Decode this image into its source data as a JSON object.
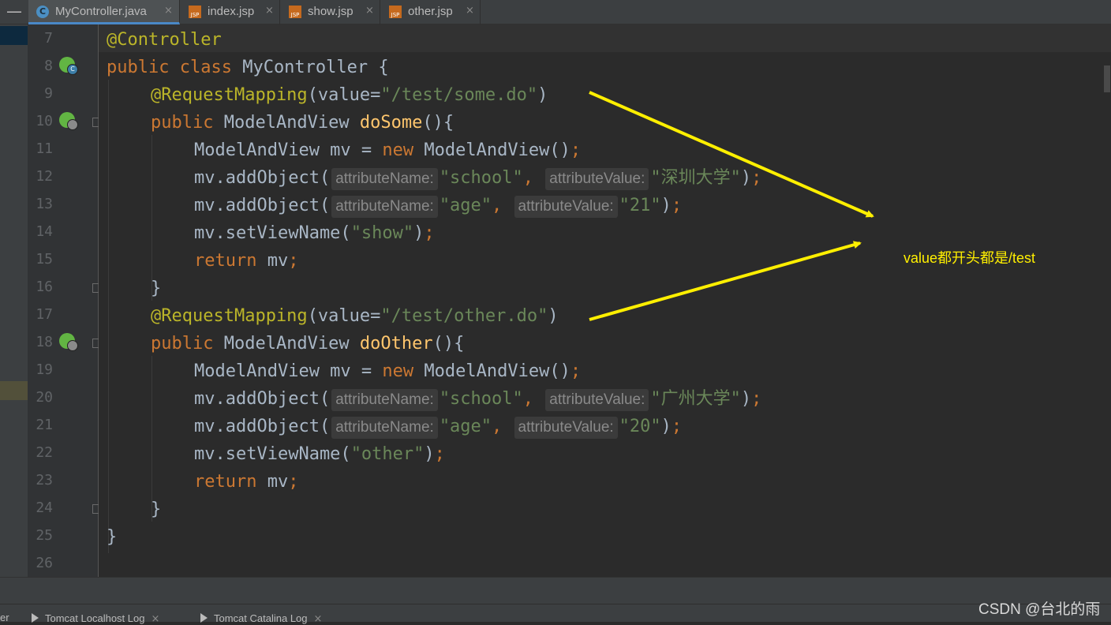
{
  "tabs": [
    {
      "label": "MyController.java",
      "icon": "java-class-icon",
      "active": true
    },
    {
      "label": "index.jsp",
      "icon": "jsp-file-icon",
      "active": false
    },
    {
      "label": "show.jsp",
      "icon": "jsp-file-icon",
      "active": false
    },
    {
      "label": "other.jsp",
      "icon": "jsp-file-icon",
      "active": false
    }
  ],
  "tab_close_glyph": "×",
  "icon_text": {
    "class_badge": "C",
    "jsp_badge": "JSP"
  },
  "line_numbers": [
    "7",
    "8",
    "9",
    "10",
    "11",
    "12",
    "13",
    "14",
    "15",
    "16",
    "17",
    "18",
    "19",
    "20",
    "21",
    "22",
    "23",
    "24",
    "25",
    "26"
  ],
  "code": {
    "l7": {
      "annotation": "@Controller"
    },
    "l8": {
      "kw1": "public ",
      "kw2": "class ",
      "rest": "MyController {"
    },
    "l9": {
      "annotation": "@RequestMapping",
      "open": "(value=",
      "str": "\"/test/some.do\"",
      "close": ")"
    },
    "l10": {
      "kw": "public ",
      "type": "ModelAndView ",
      "fn": "doSome",
      "rest": "(){"
    },
    "l11": {
      "a": "ModelAndView mv = ",
      "kw": "new ",
      "b": "ModelAndView()",
      "semi": ";"
    },
    "l12": {
      "a": "mv.addObject(",
      "h1": "attributeName:",
      "s1": "\"school\"",
      "comma": ", ",
      "h2": "attributeValue:",
      "s2": "\"深圳大学\"",
      "b": ")",
      "semi": ";"
    },
    "l13": {
      "a": "mv.addObject(",
      "h1": "attributeName:",
      "s1": "\"age\"",
      "comma": ", ",
      "h2": "attributeValue:",
      "s2": "\"21\"",
      "b": ")",
      "semi": ";"
    },
    "l14": {
      "a": "mv.setViewName(",
      "s": "\"show\"",
      "b": ")",
      "semi": ";"
    },
    "l15": {
      "kw": "return ",
      "a": "mv",
      "semi": ";"
    },
    "l16": {
      "a": "}"
    },
    "l17": {
      "annotation": "@RequestMapping",
      "open": "(value=",
      "str": "\"/test/other.do\"",
      "close": ")"
    },
    "l18": {
      "kw": "public ",
      "type": "ModelAndView ",
      "fn": "doOther",
      "rest": "(){"
    },
    "l19": {
      "a": "ModelAndView mv = ",
      "kw": "new ",
      "b": "ModelAndView()",
      "semi": ";"
    },
    "l20": {
      "a": "mv.addObject(",
      "h1": "attributeName:",
      "s1": "\"school\"",
      "comma": ", ",
      "h2": "attributeValue:",
      "s2": "\"广州大学\"",
      "b": ")",
      "semi": ";"
    },
    "l21": {
      "a": "mv.addObject(",
      "h1": "attributeName:",
      "s1": "\"age\"",
      "comma": ", ",
      "h2": "attributeValue:",
      "s2": "\"20\"",
      "b": ")",
      "semi": ";"
    },
    "l22": {
      "a": "mv.setViewName(",
      "s": "\"other\"",
      "b": ")",
      "semi": ";"
    },
    "l23": {
      "kw": "return ",
      "a": "mv",
      "semi": ";"
    },
    "l24": {
      "a": "}"
    },
    "l25": {
      "a": "}"
    }
  },
  "annotation_note": "value都开头都是/test",
  "bottom_tabs": [
    {
      "label": "er"
    },
    {
      "label": "Tomcat Localhost Log"
    },
    {
      "label": "Tomcat Catalina Log"
    }
  ],
  "watermark": "CSDN @台北的雨",
  "colors": {
    "keyword": "#cc7832",
    "annotation": "#bbb529",
    "string": "#6a8759",
    "method": "#ffc66d",
    "arrow": "#ffef00"
  }
}
